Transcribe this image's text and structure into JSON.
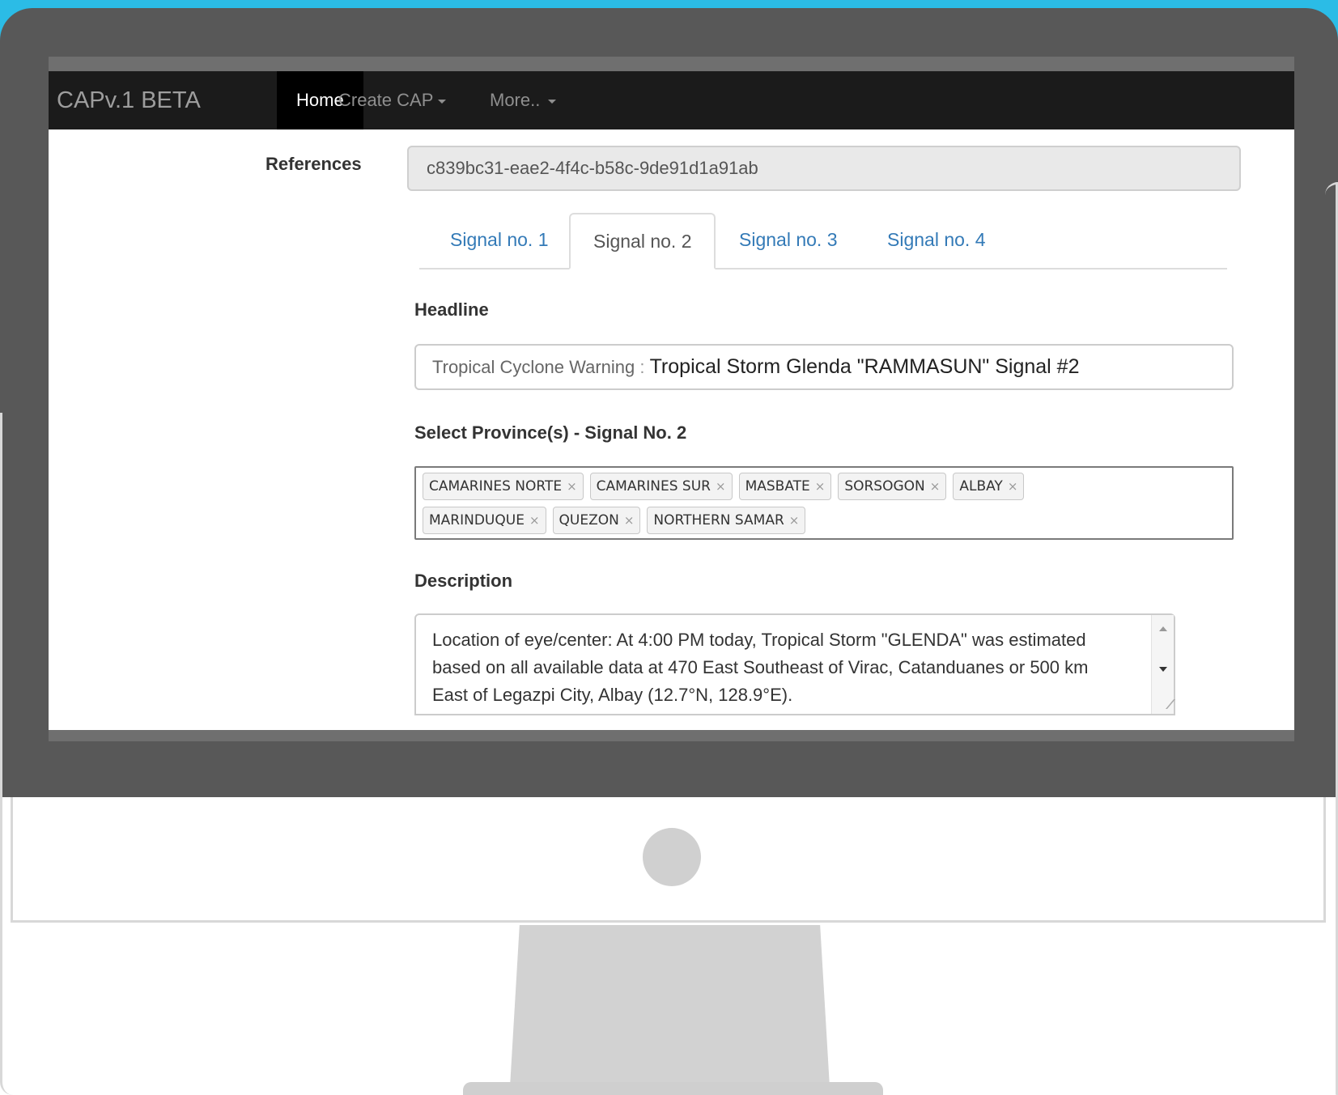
{
  "navbar": {
    "brand": "CAPv.1 BETA",
    "items": [
      {
        "label": "Home",
        "active": true
      },
      {
        "label": "Create CAP",
        "dropdown": true
      },
      {
        "label": "More..",
        "dropdown": true
      }
    ]
  },
  "references": {
    "label": "References",
    "value": "c839bc31-eae2-4f4c-b58c-9de91d1a91ab"
  },
  "tabs": [
    {
      "label": "Signal no. 1",
      "active": false
    },
    {
      "label": "Signal no. 2",
      "active": true
    },
    {
      "label": "Signal no. 3",
      "active": false
    },
    {
      "label": "Signal no. 4",
      "active": false
    }
  ],
  "headline": {
    "label": "Headline",
    "prefix": "Tropical Cyclone Warning",
    "separator": " : ",
    "value": "Tropical Storm Glenda \"RAMMASUN\" Signal #2"
  },
  "provinces": {
    "label": "Select Province(s) - Signal No. 2",
    "selected": [
      "CAMARINES NORTE",
      "CAMARINES SUR",
      "MASBATE",
      "SORSOGON",
      "ALBAY",
      "MARINDUQUE",
      "QUEZON",
      "NORTHERN SAMAR"
    ],
    "remove_glyph": "×"
  },
  "description": {
    "label": "Description",
    "value": "Location of eye/center: At 4:00 PM today, Tropical Storm \"GLENDA\" was estimated based on all available data at 470 East Southeast of Virac, Catanduanes or 500 km East of Legazpi City, Albay (12.7°N, 128.9°E)."
  },
  "colors": {
    "background_accent": "#2bbce6",
    "monitor_bezel": "#585858",
    "navbar": "#1b1b1b",
    "link": "#337ab7"
  }
}
